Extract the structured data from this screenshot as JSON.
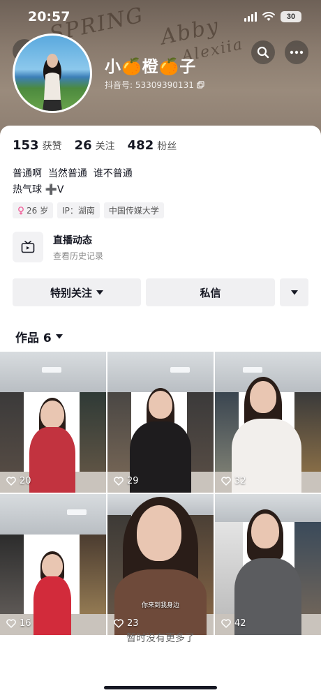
{
  "status_bar": {
    "time": "20:57",
    "battery": "30"
  },
  "header": {
    "sand_writing": [
      "SPRING",
      "Abby",
      "Alexiia"
    ],
    "nickname": "小🍊橙🍊子",
    "douyin_id": "抖音号: 53309390131"
  },
  "stats": [
    {
      "num": "153",
      "label": "获赞"
    },
    {
      "num": "26",
      "label": "关注"
    },
    {
      "num": "482",
      "label": "粉丝"
    }
  ],
  "bio": {
    "line1": "普通啊  当然普通  谁不普通",
    "line2": "热气球 ➕V"
  },
  "tags": {
    "age": "26 岁",
    "ip": "IP：湖南",
    "school": "中国传媒大学"
  },
  "live": {
    "title": "直播动态",
    "sub": "查看历史记录"
  },
  "actions": {
    "follow": "特别关注",
    "message": "私信"
  },
  "works": {
    "label": "作品 6"
  },
  "videos": [
    {
      "likes": "20"
    },
    {
      "likes": "29"
    },
    {
      "likes": "32"
    },
    {
      "likes": "16"
    },
    {
      "likes": "23",
      "caption": "你来到我身边"
    },
    {
      "likes": "42"
    }
  ],
  "footer": {
    "no_more": "暂时没有更多了"
  },
  "colors": {
    "card_bg": "#ffffff",
    "btn_bg": "#f0f0f2",
    "text": "#161823"
  }
}
